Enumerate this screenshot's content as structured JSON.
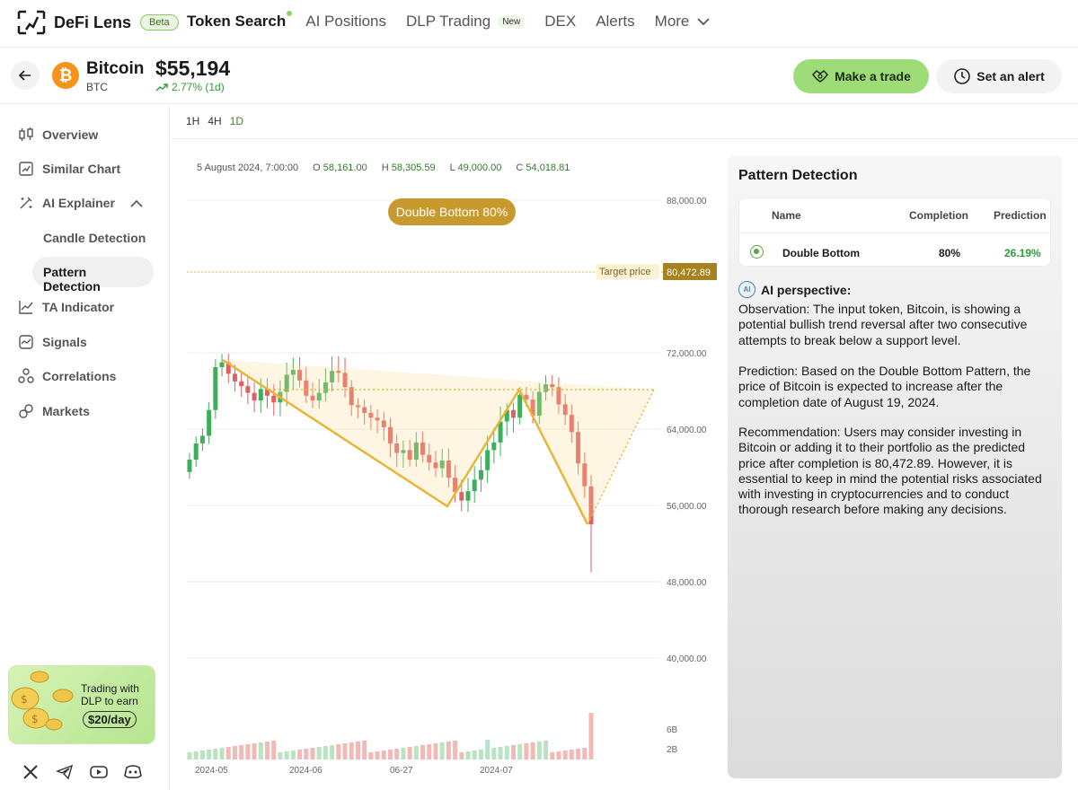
{
  "app": {
    "name": "DeFi Lens",
    "beta_label": "Beta"
  },
  "nav": [
    {
      "label": "Token Search",
      "active": true
    },
    {
      "label": "AI Positions"
    },
    {
      "label": "DLP Trading",
      "badge": "New"
    },
    {
      "label": "DEX"
    },
    {
      "label": "Alerts"
    },
    {
      "label": "More"
    }
  ],
  "token": {
    "name": "Bitcoin",
    "symbol": "BTC",
    "price": "$55,194",
    "change": "2.77% (1d)",
    "logo_letter": "₿"
  },
  "actions": {
    "trade": "Make a trade",
    "alert": "Set an alert"
  },
  "sidebar": {
    "items": [
      {
        "label": "Overview",
        "icon": "compare-icon"
      },
      {
        "label": "Similar Chart",
        "icon": "chart-box-icon"
      },
      {
        "label": "AI Explainer",
        "icon": "magic-wand-icon"
      },
      {
        "label": "TA Indicator",
        "icon": "line-chart-icon"
      },
      {
        "label": "Signals",
        "icon": "signal-icon"
      },
      {
        "label": "Correlations",
        "icon": "nodes-icon"
      },
      {
        "label": "Markets",
        "icon": "link-icon"
      }
    ],
    "sub_items": [
      "Candle Detection",
      "Pattern Detection"
    ],
    "promo": {
      "line1": "Trading with",
      "line2": "DLP to earn",
      "amount": "$20/day"
    }
  },
  "chart": {
    "timeframes": [
      "1H",
      "4H",
      "1D"
    ],
    "active_timeframe": "1D",
    "ohlc": {
      "date": "5 August 2024, 7:00:00",
      "o_label": "O",
      "o": "58,161.00",
      "h_label": "H",
      "h": "58,305.59",
      "l_label": "L",
      "l": "49,000.00",
      "c_label": "C",
      "c": "54,018.81"
    },
    "pattern_label": "Double Bottom 80%",
    "target_label": "Target price",
    "target_value": "80,472.89"
  },
  "chart_data": {
    "type": "candlestick",
    "y_ticks": [
      "88,000.00",
      "72,000.00",
      "64,000.00",
      "56,000.00",
      "48,000.00",
      "40,000.00"
    ],
    "y_tick_values": [
      88000,
      72000,
      64000,
      56000,
      48000,
      40000
    ],
    "volume_ticks": [
      "6B",
      "2B"
    ],
    "x_ticks": [
      "2024-05",
      "2024-06",
      "06-27",
      "2024-07"
    ],
    "close_series": [
      60800,
      62500,
      63300,
      66000,
      70500,
      71000,
      69800,
      69000,
      68500,
      67800,
      67000,
      68200,
      67500,
      66800,
      67900,
      69700,
      70200,
      69100,
      67500,
      67000,
      67800,
      68900,
      70100,
      69900,
      68400,
      66500,
      66300,
      65700,
      65200,
      64900,
      64200,
      62500,
      61500,
      61800,
      60800,
      62600,
      61300,
      60500,
      59900,
      60700,
      58900,
      57400,
      56500,
      57500,
      58700,
      59700,
      61800,
      62600,
      64800,
      66000,
      65200,
      67600,
      67100,
      65400,
      67900,
      68700,
      68400,
      66600,
      65500,
      63700,
      60400,
      58000,
      54018
    ],
    "pattern": {
      "name": "Double Bottom",
      "completion": "80%",
      "target": 80472.89
    },
    "grid": true
  },
  "panel": {
    "title": "Pattern Detection",
    "headers": [
      "Name",
      "Completion",
      "Prediction"
    ],
    "row": {
      "name": "Double Bottom",
      "completion": "80%",
      "prediction": "26.19%"
    },
    "ai_title": "AI perspective:",
    "ai_icon_text": "AI",
    "observation": "Observation: The input token, Bitcoin, is showing a potential bullish trend reversal after two consecutive attempts to break below a support level.",
    "prediction": "Prediction: Based on the Double Bottom Pattern, the price of Bitcoin is expected to increase after the completion date of August 19, 2024.",
    "recommendation": "Recommendation: Users may consider investing in Bitcoin or adding it to their portfolio as the predicted price after completion is 80,472.89. However, it is essential to keep in mind the potential risks associated with investing in cryptocurrencies and to conduct thorough research before making any decisions."
  },
  "colors": {
    "accent": "#9edc78",
    "up": "#3fae5a",
    "down": "#e0605f",
    "pattern": "#e8b53a"
  }
}
